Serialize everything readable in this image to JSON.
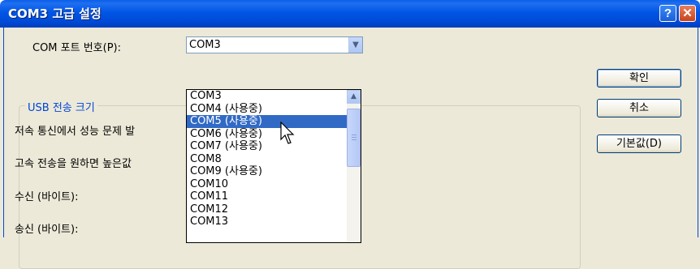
{
  "window": {
    "title": "COM3 고급 설정",
    "help_label": "?",
    "close_label": "✕"
  },
  "com_port": {
    "label": "COM 포트 번호(P):",
    "selected": "COM3",
    "options": [
      "COM3",
      "COM4 (사용중)",
      "COM5 (사용중)",
      "COM6 (사용중)",
      "COM7 (사용중)",
      "COM8",
      "COM9 (사용중)",
      "COM10",
      "COM11",
      "COM12",
      "COM13"
    ],
    "highlighted_index": 2
  },
  "usb_group": {
    "title": "USB 전송 크기",
    "low_speed_text": "저속 통신에서 성능 문제 발",
    "high_speed_text": "고속 전송을 원하면 높은값",
    "receive_label": "수신 (바이트):",
    "send_label": "송신 (바이트):"
  },
  "buttons": {
    "ok": "확인",
    "cancel": "취소",
    "default": "기본값(D)"
  },
  "icons": {
    "combo_arrow": "chevron-down-icon",
    "scroll_up": "chevron-up-icon",
    "cursor": "arrow-cursor-icon"
  }
}
